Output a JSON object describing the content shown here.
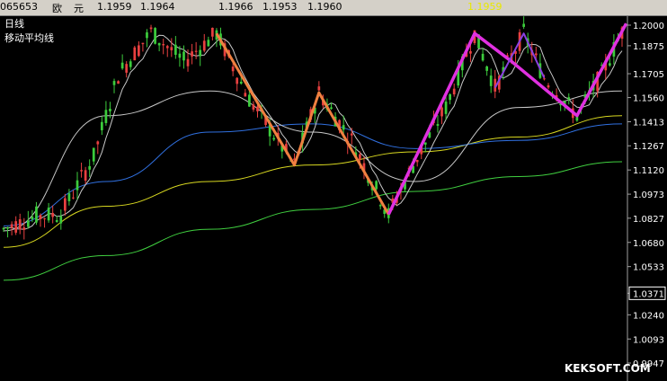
{
  "header": {
    "code": "065653",
    "name_1": "欧",
    "name_2": "元",
    "open": "1.1959",
    "high": "1.1964",
    "low_label": "1.1966",
    "close_label": "1.1953",
    "last": "1.1960",
    "current": "1.1959"
  },
  "legend": {
    "period": "日线",
    "indicator": "移动平均线"
  },
  "watermark": "KEKSOFT.COM",
  "colors": {
    "up": "#54fcfc",
    "down": "#ff5050",
    "bull_candle": "#3ccc3c",
    "bear_candle": "#e84040",
    "orange": "#f08040",
    "magenta": "#e030e0",
    "purple": "#8a40e0",
    "yellow": "#d8d820",
    "green": "#40d040",
    "blue": "#3070e0",
    "white_ma": "#c8c8c8",
    "tan_ma": "#b0a070"
  },
  "chart_data": {
    "type": "candlestick",
    "title": "",
    "ylim": [
      0.9947,
      1.2
    ],
    "y_ticks": [
      "1.2000",
      "1.1875",
      "1.1705",
      "1.1560",
      "1.1413",
      "1.1267",
      "1.1120",
      "1.0973",
      "1.0827",
      "1.0680",
      "1.0533",
      "1.0371",
      "1.0240",
      "1.0093",
      "0.9947"
    ],
    "highlight_tick": "1.0371",
    "current_value": 1.1959,
    "bars": 152,
    "swing_lines": [
      {
        "name": "orange-zigzag",
        "points": [
          [
            52,
            1.195
          ],
          [
            71,
            1.115
          ],
          [
            77,
            1.159
          ],
          [
            94,
            1.085
          ]
        ]
      },
      {
        "name": "magenta-zigzag",
        "points": [
          [
            94,
            1.085
          ],
          [
            115,
            1.195
          ],
          [
            124,
            1.178
          ],
          [
            140,
            1.145
          ],
          [
            152,
            1.201
          ]
        ]
      },
      {
        "name": "purple-zigzag",
        "points": [
          [
            120,
            1.162
          ],
          [
            127,
            1.195
          ],
          [
            132,
            1.168
          ]
        ]
      }
    ],
    "ma_series": [
      {
        "name": "ma200",
        "color": "green",
        "values": [
          1.045,
          1.06,
          1.076,
          1.088,
          1.099,
          1.108,
          1.117
        ]
      },
      {
        "name": "ma120",
        "color": "yellow",
        "values": [
          1.065,
          1.09,
          1.105,
          1.115,
          1.123,
          1.132,
          1.145
        ]
      },
      {
        "name": "ma60",
        "color": "blue",
        "values": [
          1.078,
          1.105,
          1.135,
          1.14,
          1.125,
          1.13,
          1.14
        ]
      },
      {
        "name": "ma30",
        "color": "white_ma",
        "values": [
          1.075,
          1.145,
          1.16,
          1.135,
          1.105,
          1.15,
          1.16
        ]
      }
    ]
  }
}
